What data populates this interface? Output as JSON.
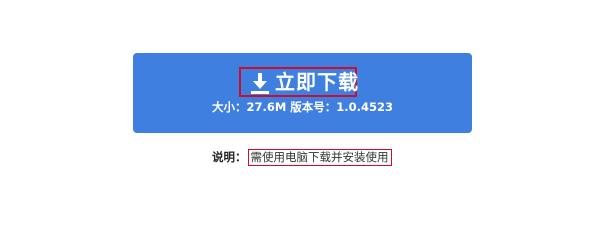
{
  "download_button": {
    "label": "立即下载",
    "size_label": "大小：",
    "size_value": "27.6M",
    "version_label": "版本号：",
    "version_value": "1.0.4523",
    "color": "#3f7fe0",
    "icon": "download-icon"
  },
  "note": {
    "label": "说明",
    "colon": "：",
    "text": "需使用电脑下载并安装使用"
  },
  "highlight_color": "#c8102e"
}
